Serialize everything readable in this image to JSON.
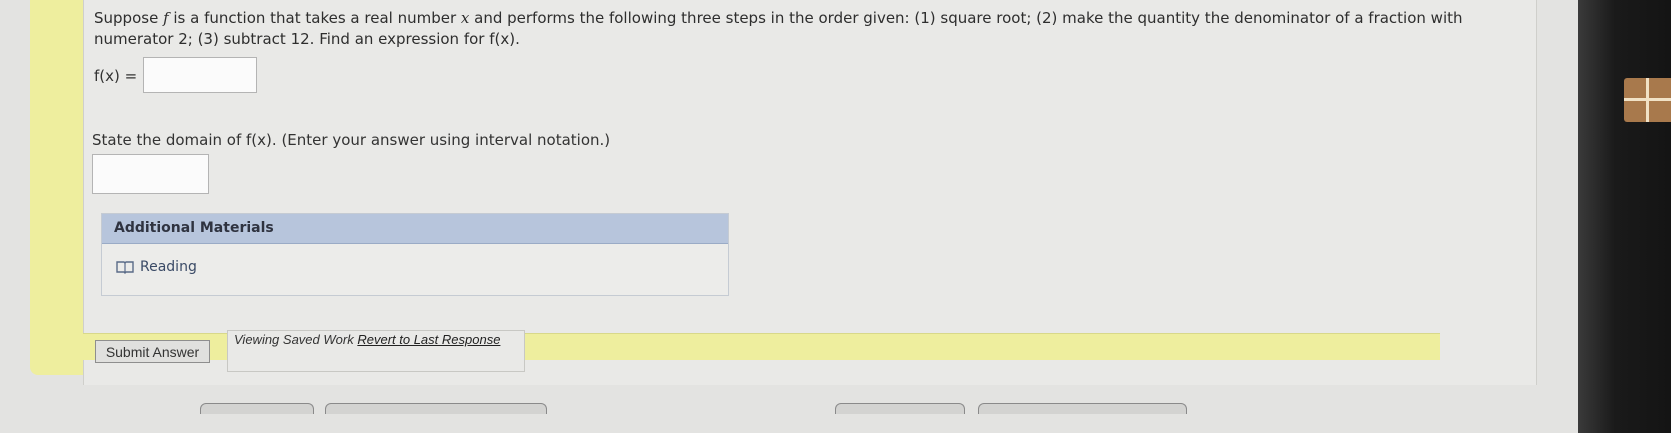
{
  "question": {
    "intro_prefix": "Suppose ",
    "f_var": "f",
    "intro_mid": " is a function that takes a real number ",
    "x_var": "x",
    "intro_rest": " and performs the following three steps in the order given: (1) square root; (2) make the quantity the denominator of a fraction with numerator 2; (3) subtract 12. Find an expression for ",
    "fx_expr": "f(x)",
    "intro_end": "."
  },
  "fx_label": "f(x) =",
  "fx_value": "",
  "domain_prefix": "State the domain of ",
  "domain_expr": "f(x)",
  "domain_suffix": ". (Enter your answer using interval notation.)",
  "domain_value": "",
  "materials": {
    "header": "Additional Materials",
    "reading_label": "Reading",
    "reading_icon": "book-icon"
  },
  "submit_label": "Submit Answer",
  "saved_work": {
    "viewing": "Viewing Saved Work",
    "revert": "Revert to Last Response"
  },
  "colors": {
    "highlight_yellow": "#eeee9e",
    "materials_header": "#b7c5dc"
  }
}
